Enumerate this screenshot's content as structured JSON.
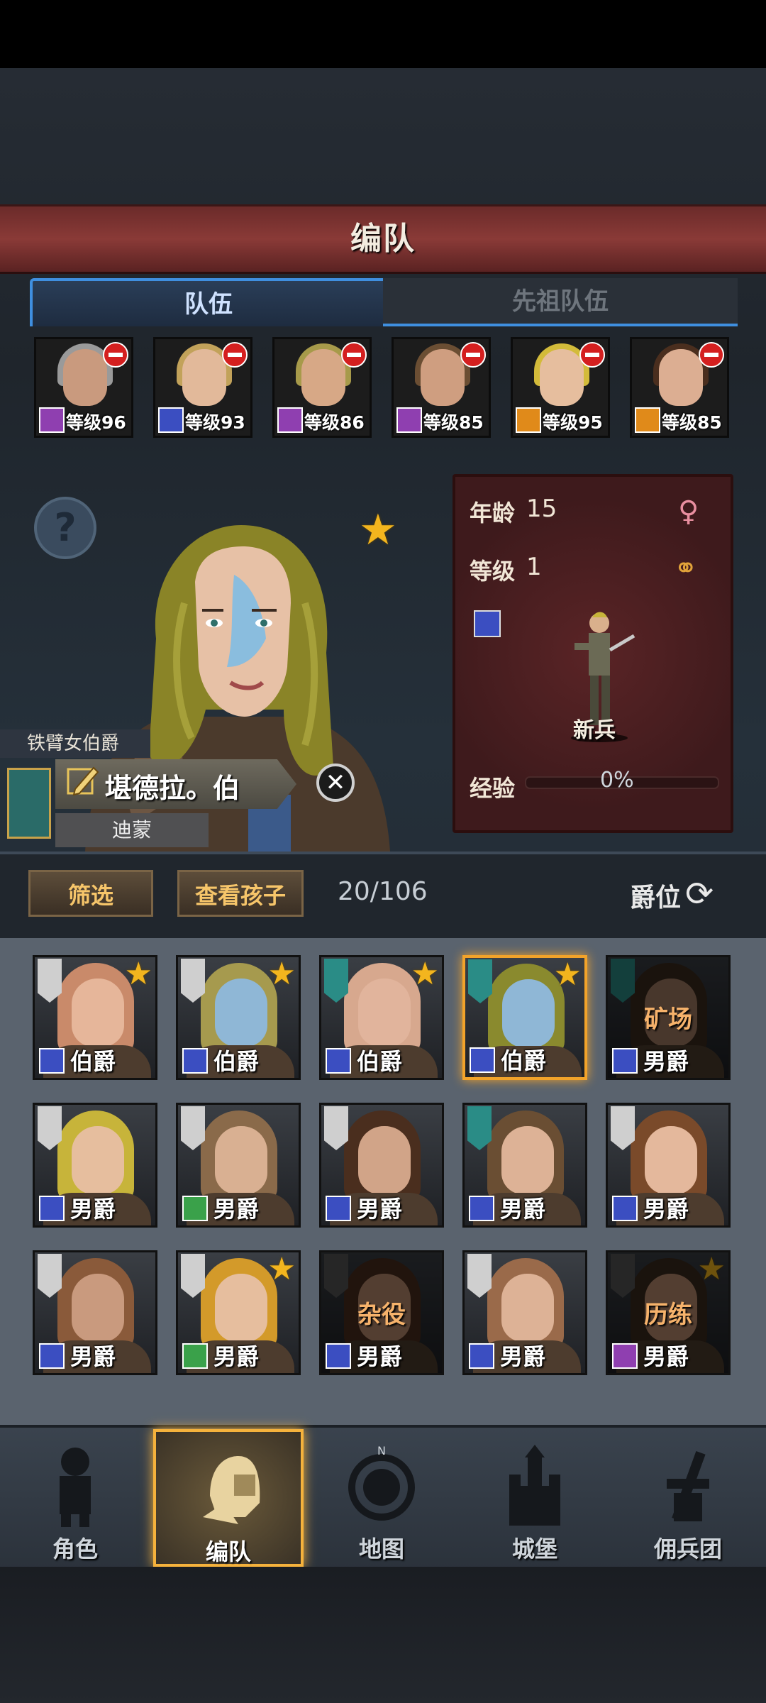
{
  "header": {
    "title": "编队"
  },
  "tabs": [
    {
      "label": "队伍",
      "active": true
    },
    {
      "label": "先祖队伍",
      "active": false
    }
  ],
  "team": [
    {
      "level": "等级96",
      "class_color": "#8f3fb0",
      "hair": "#9a9a9a",
      "skin": "#c99a7e"
    },
    {
      "level": "等级93",
      "class_color": "#3b4ec1",
      "hair": "#c2a25a",
      "skin": "#e2b99a"
    },
    {
      "level": "等级86",
      "class_color": "#8f3fb0",
      "hair": "#a79a4a",
      "skin": "#d7a886"
    },
    {
      "level": "等级85",
      "class_color": "#8f3fb0",
      "hair": "#6b4e33",
      "skin": "#cf9e80"
    },
    {
      "level": "等级95",
      "class_color": "#e08a1a",
      "hair": "#d3bb3a",
      "skin": "#e6be9e"
    },
    {
      "level": "等级85",
      "class_color": "#e08a1a",
      "hair": "#4a2e1e",
      "skin": "#dcae92"
    }
  ],
  "hero": {
    "age_label": "年龄",
    "age": "15",
    "level_label": "等级",
    "level": "1",
    "class_name": "新兵",
    "exp_label": "经验",
    "exp_percent": "0%",
    "title": "铁臂女伯爵",
    "name": "堪德拉。伯",
    "house": "迪蒙"
  },
  "filter": {
    "filter_label": "筛选",
    "children_label": "查看孩子",
    "count": "20/106",
    "rank_label": "爵位"
  },
  "roster": [
    {
      "rank": "伯爵",
      "star": true,
      "flag": "#cfcfcf",
      "class_color": "#3b4ec1",
      "hair": "#c98a6a",
      "skin": "#e6b69a"
    },
    {
      "rank": "伯爵",
      "star": true,
      "flag": "#cfcfcf",
      "class_color": "#3b4ec1",
      "hair": "#a69a4e",
      "skin": "#8fb7d6"
    },
    {
      "rank": "伯爵",
      "star": true,
      "flag": "#2a8c86",
      "class_color": "#3b4ec1",
      "hair": "#d7a88e",
      "skin": "#e1b49c"
    },
    {
      "rank": "伯爵",
      "star": true,
      "flag": "#2a8c86",
      "class_color": "#3b4ec1",
      "hair": "#8a8a2e",
      "skin": "#8fb7d6",
      "selected": true
    },
    {
      "rank": "男爵",
      "star": false,
      "flag": "#2a8c86",
      "class_color": "#3b4ec1",
      "hair": "#3b2a1e",
      "skin": "#a07a62",
      "status": "矿场"
    },
    {
      "rank": "男爵",
      "star": false,
      "flag": "#cfcfcf",
      "class_color": "#3b4ec1",
      "hair": "#c7b43a",
      "skin": "#e6be9e"
    },
    {
      "rank": "男爵",
      "star": false,
      "flag": "#cfcfcf",
      "class_color": "#3aa14a",
      "hair": "#8a6a4a",
      "skin": "#d9b092"
    },
    {
      "rank": "男爵",
      "star": false,
      "flag": "#cfcfcf",
      "class_color": "#3b4ec1",
      "hair": "#4a2e1e",
      "skin": "#d1a488"
    },
    {
      "rank": "男爵",
      "star": false,
      "flag": "#2a8c86",
      "class_color": "#3b4ec1",
      "hair": "#6a4e33",
      "skin": "#ddb296"
    },
    {
      "rank": "男爵",
      "star": false,
      "flag": "#cfcfcf",
      "class_color": "#3b4ec1",
      "hair": "#7a4a2a",
      "skin": "#e4b89c"
    },
    {
      "rank": "男爵",
      "star": false,
      "flag": "#cfcfcf",
      "class_color": "#3b4ec1",
      "hair": "#8a5a3a",
      "skin": "#c99a7e"
    },
    {
      "rank": "男爵",
      "star": true,
      "flag": "#cfcfcf",
      "class_color": "#3aa14a",
      "hair": "#d39a2a",
      "skin": "#e6be9e"
    },
    {
      "rank": "男爵",
      "star": false,
      "flag": "#555555",
      "class_color": "#3b4ec1",
      "hair": "#4a2e1e",
      "skin": "#b88a6e",
      "status": "杂役"
    },
    {
      "rank": "男爵",
      "star": false,
      "flag": "#cfcfcf",
      "class_color": "#3b4ec1",
      "hair": "#9a6a4a",
      "skin": "#ddb296"
    },
    {
      "rank": "男爵",
      "star": true,
      "flag": "#555555",
      "class_color": "#8f3fb0",
      "hair": "#3b2a1e",
      "skin": "#b88a6e",
      "status": "历练"
    }
  ],
  "nav": [
    {
      "label": "角色",
      "icon": "knight-icon",
      "active": false
    },
    {
      "label": "编队",
      "icon": "helmet-icon",
      "active": true
    },
    {
      "label": "地图",
      "icon": "compass-icon",
      "active": false
    },
    {
      "label": "城堡",
      "icon": "castle-icon",
      "active": false
    },
    {
      "label": "佣兵团",
      "icon": "mercenary-icon",
      "active": false
    }
  ]
}
